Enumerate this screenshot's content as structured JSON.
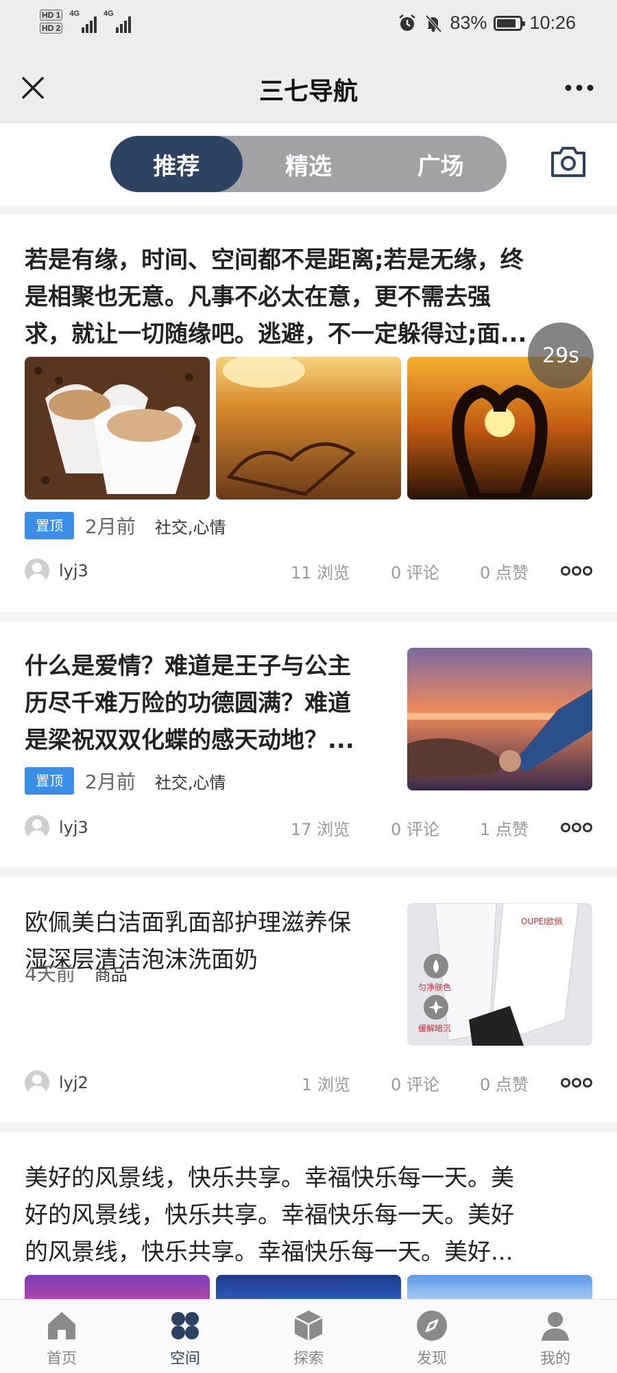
{
  "status_bar": {
    "hd1": "HD 1",
    "hd2": "HD 2",
    "net1": "4G",
    "net2": "4G",
    "battery": "83%",
    "battery_level": 0.83,
    "time": "10:26",
    "icons": [
      "alarm-icon",
      "mute-bell-icon",
      "battery-icon"
    ]
  },
  "nav": {
    "title": "三七导航",
    "close_icon": "close-icon",
    "more_icon": "more-icon"
  },
  "tabs": {
    "items": [
      "推荐",
      "精选",
      "广场"
    ],
    "active": 0,
    "camera_icon": "camera-icon"
  },
  "posts": [
    {
      "title_lines": [
        "若是有缘，时间、空间都不是距离;若是无缘，终",
        "是相聚也无意。凡事不必太在意，更不需去强",
        "求，就让一切随缘吧。逃避，不一定躲得过;面..."
      ],
      "images": [
        "heart-coffee-cups",
        "sand-heart-sunset",
        "hands-heart-sunset"
      ],
      "timer": "29s",
      "pinned": "置顶",
      "time": "2月前",
      "category": "社交,心情",
      "user": "lyj3",
      "views": "11 浏览",
      "comments": "0 评论",
      "likes": "0 点赞"
    },
    {
      "title_lines": [
        "什么是爱情？难道是王子与公主",
        "历尽千难万险的功德圆满？难道",
        "是梁祝双双化蝶的感天动地？..."
      ],
      "images": [
        "holding-hands-sunset"
      ],
      "pinned": "置顶",
      "time": "2月前",
      "category": "社交,心情",
      "user": "lyj3",
      "views": "17 浏览",
      "comments": "0 评论",
      "likes": "1 点赞"
    },
    {
      "title_lines": [
        "欧佩美白洁面乳面部护理滋养保",
        "湿深层清洁泡沫洗面奶"
      ],
      "images": [
        "cleanser-product"
      ],
      "product_labels": [
        "OUPEI欧佩",
        "匀净肤色",
        "缓解暗沉"
      ],
      "time": "4天前",
      "category": "商品",
      "user": "lyj2",
      "views": "1 浏览",
      "comments": "0 评论",
      "likes": "0 点赞"
    },
    {
      "title_lines": [
        "美好的风景线，快乐共享。幸福快乐每一天。美",
        "好的风景线，快乐共享。幸福快乐每一天。美好",
        "的风景线，快乐共享。幸福快乐每一天。美好..."
      ],
      "images": [
        "purple-sky",
        "blue-sky",
        "cloud-sky"
      ]
    }
  ],
  "bottom_nav": [
    {
      "label": "首页",
      "icon": "home-icon"
    },
    {
      "label": "空间",
      "icon": "space-icon"
    },
    {
      "label": "探索",
      "icon": "cube-icon"
    },
    {
      "label": "发现",
      "icon": "compass-icon"
    },
    {
      "label": "我的",
      "icon": "user-icon"
    }
  ],
  "bottom_nav_active": 1,
  "colors": {
    "accent": "#2c4363",
    "pin_tag": "#3a8ee6",
    "background": "#f4f4f5"
  }
}
